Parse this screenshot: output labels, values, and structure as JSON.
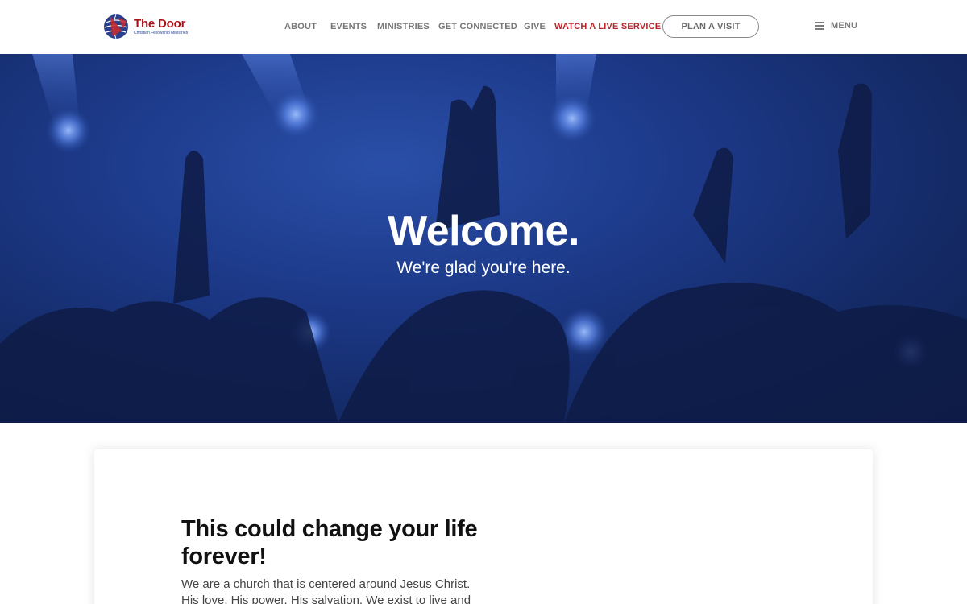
{
  "brand": {
    "name": "The Door",
    "tagline": "Christian Fellowship Ministries"
  },
  "nav": {
    "items": [
      {
        "label": "ABOUT"
      },
      {
        "label": "EVENTS"
      },
      {
        "label": "MINISTRIES"
      },
      {
        "label": "GET CONNECTED"
      },
      {
        "label": "GIVE"
      },
      {
        "label": "WATCH A LIVE SERVICE"
      }
    ],
    "cta_label": "PLAN A VISIT",
    "menu_label": "MENU",
    "menu_icon": "hamburger-icon"
  },
  "hero": {
    "title": "Welcome.",
    "subtitle": "We're glad you're here."
  },
  "intro": {
    "heading": "This could change your life forever!",
    "body": "We are a church that is centered around Jesus Christ. His love. His power. His salvation. We exist to live and share this"
  },
  "colors": {
    "brand_red": "#b5252b",
    "brand_blue": "#2a3f8c",
    "hero_blue": "#1d3a8a",
    "nav_gray": "#777777"
  }
}
